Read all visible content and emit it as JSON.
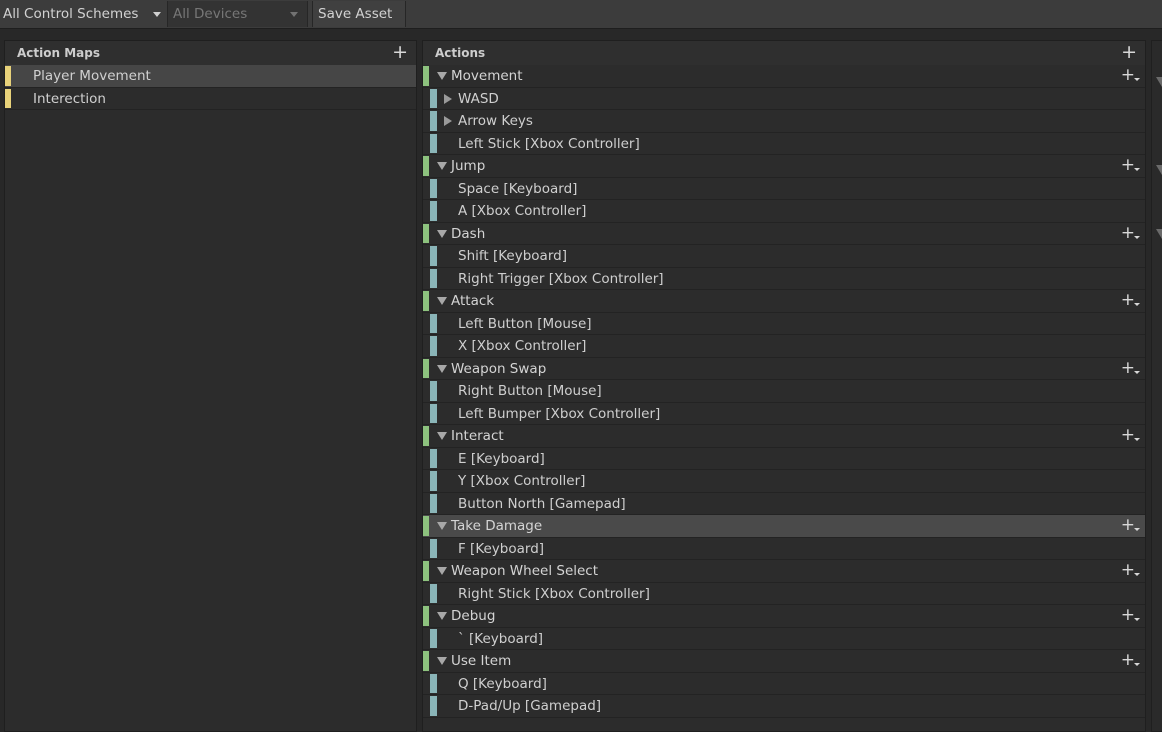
{
  "toolbar": {
    "control_schemes": "All Control Schemes",
    "devices": "All Devices",
    "save": "Save Asset"
  },
  "action_maps": {
    "title": "Action Maps",
    "add_icon": "+",
    "items": [
      {
        "label": "Player Movement",
        "selected": true
      },
      {
        "label": "Interection",
        "selected": false
      }
    ]
  },
  "actions": {
    "title": "Actions",
    "add_icon": "+",
    "add_binding_icon": "+",
    "rows": [
      {
        "type": "action",
        "label": "Movement"
      },
      {
        "type": "composite",
        "label": "WASD"
      },
      {
        "type": "composite",
        "label": "Arrow Keys"
      },
      {
        "type": "binding",
        "label": "Left Stick [Xbox Controller]"
      },
      {
        "type": "action",
        "label": "Jump"
      },
      {
        "type": "binding",
        "label": "Space [Keyboard]"
      },
      {
        "type": "binding",
        "label": "A [Xbox Controller]"
      },
      {
        "type": "action",
        "label": "Dash"
      },
      {
        "type": "binding",
        "label": "Shift [Keyboard]"
      },
      {
        "type": "binding",
        "label": "Right Trigger [Xbox Controller]"
      },
      {
        "type": "action",
        "label": "Attack"
      },
      {
        "type": "binding",
        "label": "Left Button [Mouse]"
      },
      {
        "type": "binding",
        "label": "X [Xbox Controller]"
      },
      {
        "type": "action",
        "label": "Weapon Swap"
      },
      {
        "type": "binding",
        "label": "Right Button [Mouse]"
      },
      {
        "type": "binding",
        "label": "Left Bumper [Xbox Controller]"
      },
      {
        "type": "action",
        "label": "Interact"
      },
      {
        "type": "binding",
        "label": "E [Keyboard]"
      },
      {
        "type": "binding",
        "label": "Y [Xbox Controller]"
      },
      {
        "type": "binding",
        "label": "Button North [Gamepad]"
      },
      {
        "type": "action",
        "label": "Take Damage",
        "selected": true
      },
      {
        "type": "binding",
        "label": "F [Keyboard]"
      },
      {
        "type": "action",
        "label": "Weapon Wheel Select"
      },
      {
        "type": "binding",
        "label": "Right Stick [Xbox Controller]"
      },
      {
        "type": "action",
        "label": "Debug"
      },
      {
        "type": "binding",
        "label": "` [Keyboard]"
      },
      {
        "type": "action",
        "label": "Use Item"
      },
      {
        "type": "binding",
        "label": "Q [Keyboard]"
      },
      {
        "type": "binding",
        "label": "D-Pad/Up [Gamepad]"
      }
    ]
  },
  "colors": {
    "action_map_accent": "#e8d27a",
    "action_accent": "#8dc27e",
    "binding_accent": "#8ab5b8",
    "selected_row": "#464646"
  }
}
